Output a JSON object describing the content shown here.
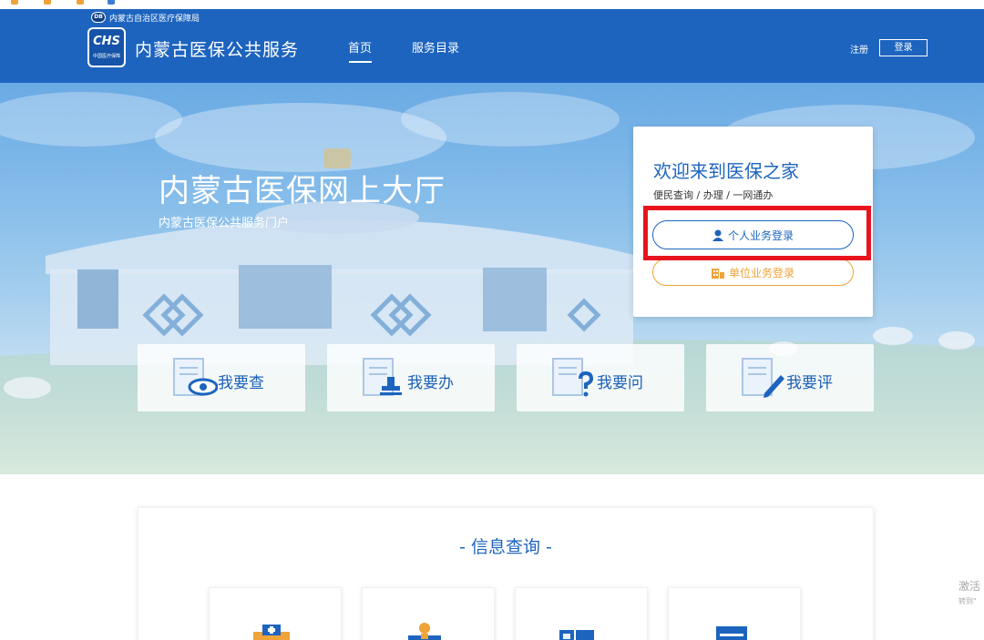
{
  "header": {
    "bureau_label": "内蒙古自治区医疗保障局",
    "logo_mark": "CHS",
    "logo_caption": "中国医疗保障",
    "site_title": "内蒙古医保公共服务",
    "nav": {
      "home": "首页",
      "catalog": "服务目录"
    },
    "register": "注册",
    "login": "登录"
  },
  "hero": {
    "title": "内蒙古医保网上大厅",
    "subtitle": "内蒙古医保公共服务门户"
  },
  "welcome": {
    "title": "欢迎来到医保之家",
    "subtitle": "便民查询 / 办理 / 一网通办",
    "personal_login": "个人业务登录",
    "company_login": "单位业务登录"
  },
  "services": [
    {
      "label": "我要查",
      "icon": "document-eye-icon"
    },
    {
      "label": "我要办",
      "icon": "document-stamp-icon"
    },
    {
      "label": "我要问",
      "icon": "document-question-icon"
    },
    {
      "label": "我要评",
      "icon": "document-pen-icon"
    }
  ],
  "info": {
    "title": "- 信息查询 -",
    "cards": [
      "medical-kit-icon",
      "person-card-icon",
      "id-card-icon",
      "clipboard-icon"
    ]
  },
  "watermark": {
    "line1": "激活",
    "line2": "转到\""
  },
  "colors": {
    "brand_blue": "#1d64bf",
    "orange": "#f0a338",
    "highlight_red": "#e8141d"
  }
}
